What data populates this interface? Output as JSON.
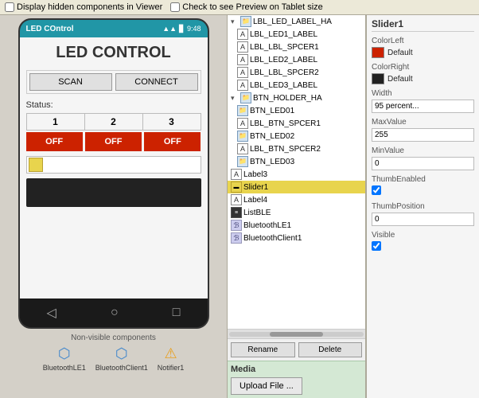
{
  "topBar": {
    "checkbox1Label": "Display hidden components in Viewer",
    "checkbox2Label": "Check to see Preview on Tablet size"
  },
  "phone": {
    "statusBar": {
      "title": "LED COntrol",
      "time": "9:48"
    },
    "content": {
      "title": "LED CONTROL",
      "scanBtn": "SCAN",
      "connectBtn": "CONNECT",
      "statusLabel": "Status:",
      "ledNumbers": [
        "1",
        "2",
        "3"
      ],
      "offButtons": [
        "OFF",
        "OFF",
        "OFF"
      ]
    },
    "navBar": {
      "back": "◁",
      "home": "○",
      "menu": "□"
    }
  },
  "nonVisible": {
    "label": "Non-visible components",
    "items": [
      {
        "id": "bluetooth-le1",
        "label": "BluetoothLE1",
        "icon": "bt"
      },
      {
        "id": "bluetooth-client1",
        "label": "BluetoothClient1",
        "icon": "bt"
      },
      {
        "id": "notifier1",
        "label": "Notifier1",
        "icon": "warn"
      }
    ]
  },
  "tree": {
    "items": [
      {
        "level": 0,
        "icon": "folder",
        "label": "LBL_LED_LABEL_HA",
        "collapse": "▾"
      },
      {
        "level": 1,
        "icon": "A",
        "label": "LBL_LED1_LABEL"
      },
      {
        "level": 1,
        "icon": "A",
        "label": "LBL_LBL_SPCER1"
      },
      {
        "level": 1,
        "icon": "A",
        "label": "LBL_LED2_LABEL"
      },
      {
        "level": 1,
        "icon": "A",
        "label": "LBL_LBL_SPCER2"
      },
      {
        "level": 1,
        "icon": "A",
        "label": "LBL_LED3_LABEL"
      },
      {
        "level": 0,
        "icon": "folder",
        "label": "BTN_HOLDER_HA",
        "collapse": "▾"
      },
      {
        "level": 1,
        "icon": "folder",
        "label": "BTN_LED01"
      },
      {
        "level": 1,
        "icon": "A",
        "label": "LBL_BTN_SPCER1"
      },
      {
        "level": 1,
        "icon": "folder",
        "label": "BTN_LED02"
      },
      {
        "level": 1,
        "icon": "A",
        "label": "LBL_BTN_SPCER2"
      },
      {
        "level": 1,
        "icon": "folder",
        "label": "BTN_LED03"
      },
      {
        "level": 0,
        "icon": "A",
        "label": "Label3"
      },
      {
        "level": 0,
        "icon": "slider",
        "label": "Slider1",
        "selected": true
      },
      {
        "level": 0,
        "icon": "A",
        "label": "Label4"
      },
      {
        "level": 0,
        "icon": "list",
        "label": "ListBLE"
      },
      {
        "level": 0,
        "icon": "bt",
        "label": "BluetoothLE1"
      },
      {
        "level": 0,
        "icon": "bt",
        "label": "BluetoothClient1"
      }
    ],
    "renameBtn": "Rename",
    "deleteBtn": "Delete"
  },
  "media": {
    "label": "Media",
    "uploadBtn": "Upload File ..."
  },
  "props": {
    "title": "Slider1",
    "properties": [
      {
        "name": "ColorLeft",
        "type": "color",
        "value": "Default",
        "color": "#cc2200"
      },
      {
        "name": "ColorRight",
        "type": "color",
        "value": "Default",
        "color": "#222222"
      },
      {
        "name": "Width",
        "type": "input",
        "value": "95 percent..."
      },
      {
        "name": "MaxValue",
        "type": "input",
        "value": "255"
      },
      {
        "name": "MinValue",
        "type": "input",
        "value": "0"
      },
      {
        "name": "ThumbEnabled",
        "type": "checkbox",
        "checked": true
      },
      {
        "name": "ThumbPosition",
        "type": "input",
        "value": "0"
      },
      {
        "name": "Visible",
        "type": "checkbox",
        "checked": true
      }
    ]
  }
}
